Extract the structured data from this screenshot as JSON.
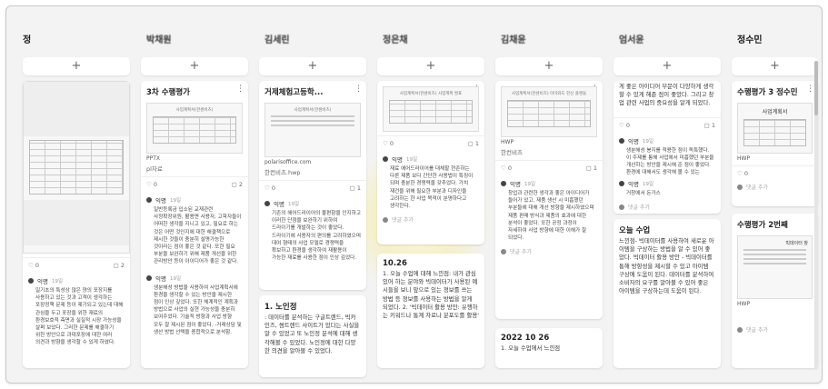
{
  "columns": [
    {
      "title": "정",
      "add_label": "+",
      "cards": [
        {
          "type": "file",
          "counts": {
            "likes": "0",
            "comments": "2"
          },
          "author": "익명",
          "date": "19일",
          "body": "일기초의 특성상 많은 양의 포장지를 사용하고 있는 것과 고객이 생각하는 포장정책 문제 등이 제기되고 있는데 대해 관심을 두고 포장을 위한 재료의 환경보호적 측면과 실질적 시장 가능성을 살펴 보았다. 그러한 문제를 해결하기 위한 방안으로 과대포장에 대한 여러 의견과 방향을 생각할 수 있게 하였다."
        }
      ]
    },
    {
      "title": "박채원",
      "add_label": "+",
      "cards": [
        {
          "type": "file",
          "title": "3차 수행평가",
          "doc_title": "사업계획서(한센비츠)",
          "ftype": "PPTX",
          "fname": "pl차료",
          "counts": {
            "likes": "0",
            "comments": "2"
          },
          "author": "익명",
          "date": "19일",
          "body": "일반등록금 입소된 교재관련 사정확장위원, 활용면 사용자, 고학자들이 어떠한 생각을 지니고 있고, 필요로 하는 것은 어떤 것인지에 대한 해결책으로 제시한 것들이 충분히 설명가능한 것이라는 점이 좋은 것 같다. 또한 필요 부분을 보완하기 위해 제품 개선을 위한 관리방안 등이 아이디어가 좋은 것 같다.",
          "author2": "익명",
          "date2": "19일",
          "body2": "생분해성 방법을 사용하여 사업계획서에 환경을 생각할 수 있는 방안을 제시한 점이 인상 깊었다. 또한 체계적인 계획과 방법으로 사업의 실현 가능성을 충분히 보여주었다. 기술적 방향과 사업 방향 모두 잘 제시된 점이 좋았다. -거래상담 및 생산 방법 선택을 종합적으로 분석함."
        }
      ]
    },
    {
      "title": "김세린",
      "add_label": "+",
      "cards": [
        {
          "type": "file",
          "title": "거제체험고등학...",
          "doc_title": "사업계획서(한센비츠)",
          "ftype": "polarisoffice.com",
          "fname": "한컨비츠.hwp",
          "counts": {
            "likes": "0",
            "comments": "1"
          },
          "author": "익명",
          "date": "19일",
          "body": "기존의 헤어드라이어의 불편함을 인지하고 이러한 단점을 보완하기 위하여 드라이기를 개발하는 것이 좋았다. 드라이기에 사용자의 편의를 고려하였으며 대여 형태의 사업 모델로 경쟁력을 확보하고 환경을 생각하여 재활용이 가능한 재료를 사용한 점이 인상 깊었다.",
          "text_title": "1. 노인정",
          "text_body": ": 데이터를 분석하는 구글트렌드, 빅카인즈, 썸트렌드 사이트가 있다는 사실을 알 수 있었고 또 노인정 분석에 대해 생각해볼 수 있었다. 노인정에 대한 다양한 의견을 알아볼 수 있었다."
        }
      ]
    },
    {
      "title": "정은채",
      "add_label": "+",
      "cards": [
        {
          "type": "file",
          "doc_title": "사업계획서(한센비츠) 사업계획 발표",
          "counts": {
            "likes": "0",
            "comments": "1"
          },
          "author": "익명",
          "date": "19일",
          "body": "재료 에어드라이어를 대체할 현존하는 다른 제품 보다 간단한 사용법이 특징이 되며 충분한 경쟁력을 갖추었다. 가치 재건을 위해 필요한 부분과 디자인을 고려하는 한 사업 목적이 분명하다고 생각한다.",
          "add_comment": "댓글 추가",
          "text_title": "10.26",
          "text_body": "1. 오늘 수업에 대해 느낀점: 내가 관심있어 하는 분야와 빅데이터가 사용된 예시들을 보니 앞으로 있는 정보를 쓰는 방법 등 정보를 사용하는 방법을 알게 되었다. 2. '빅데이터 활용 방안: 유행하는 키워드나 통계 자료나 분포도를 활용'"
        }
      ]
    },
    {
      "title": "김채윤",
      "add_label": "+",
      "cards": [
        {
          "type": "file",
          "doc_title": "사업계획서(한센비츠) 이미와도 헌신 플랜들",
          "ftype": "HWP",
          "fname": "한컨비츠",
          "counts": {
            "likes": "0",
            "comments": "1"
          },
          "author": "익명",
          "date": "19일",
          "body": "창업과 관련한 생각과 좋은 아이디어가 들어가 있고, 제품 생산 시 미흡했던 부분들에 대해 개선 방향을 제시하였으며 제품 판매 방식과 제품의 효과에 대한 분석이 좋았다. 또한 공정 과정이 자세하여 사업 방향에 대한 이해가 잘 되었다.",
          "add_comment": "댓글 추가",
          "text_title": "2022 10 26",
          "text_body": "1. 오늘 수업에서 느낀점"
        }
      ]
    },
    {
      "title": "엄서윤",
      "add_label": "+",
      "cards": [
        {
          "type": "text_top",
          "text_body": "게 좋은 아이디어 부문이 다양하게 생각 할 수 있게 해준 점이 좋았다. 그리고 창업 관련 사업의 중요성을 알게 되었다.",
          "counts": {
            "likes": "0",
            "comments": "1"
          },
          "author": "익명",
          "date": "19일",
          "body": "생분해성 봉지를 적용한 점이 독특했다. 이 주제를 통해 사업에서 미흡했던 부분을 개선하는 방안을 제시해 준 점이 좋았다. 환경에 대해서도 생각해 볼 수 있는 사업이라 인상 깊었다. 좋은 사업 구상이다. -창생의 창업-",
          "author2": "익명",
          "date2": "19일",
          "body2": "거창에서 돈가스",
          "add_comment": "댓글 추가",
          "text_title": "오늘 수업",
          "text_body2": "느낀점- 빅데이터를 사용하여 새로운 아이템을 구상하는 방법을 알 수 있어 좋았다. 빅데이터 활용 방안 - 빅데이터를 통해 방향성을 제시할 수 있고 아이템 구상에 도움이 된다. 데이터를 분석하여 소비자의 요구를 알아볼 수 있어 좋은 아이템을 구상하는데 도움이 된다."
        }
      ]
    },
    {
      "title": "정수민",
      "add_label": "+",
      "cards": [
        {
          "type": "file",
          "title": "수행평가 3 정수민",
          "doc_title": "사업계획서",
          "ftype": "HWP",
          "fname": "",
          "counts": {
            "likes": "0",
            "comments": ""
          },
          "add_comment": "댓글 추가"
        },
        {
          "type": "file",
          "title": "수행평가 2번째",
          "doc_title": "빅데이터 창",
          "ftype": "HWP",
          "fname": "",
          "add_comment": "댓글 추가"
        }
      ]
    }
  ],
  "icons": {
    "like": "heart-outline-icon",
    "comment": "comment-bubble-icon",
    "more": "kebab-icon",
    "add": "plus-icon"
  }
}
